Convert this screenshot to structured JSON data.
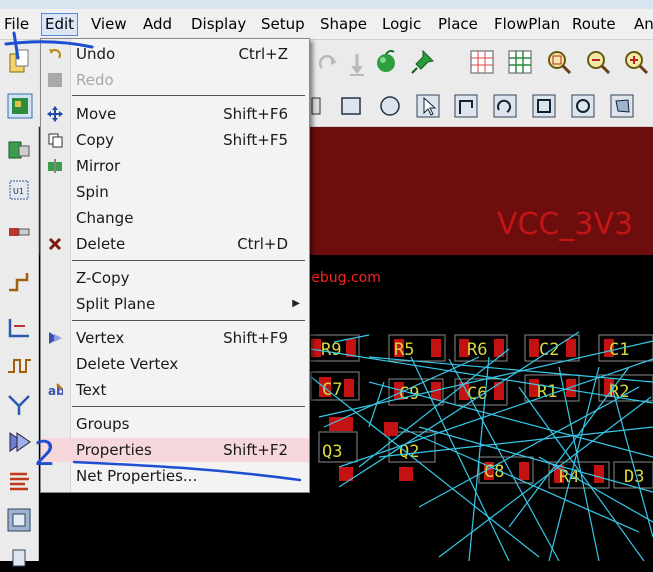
{
  "menubar": {
    "items": [
      "File",
      "Edit",
      "View",
      "Add",
      "Display",
      "Setup",
      "Shape",
      "Logic",
      "Place",
      "FlowPlan",
      "Route",
      "An"
    ],
    "active": "Edit"
  },
  "edit_menu": {
    "items": [
      {
        "label": "Undo",
        "shortcut": "Ctrl+Z",
        "icon": "undo-icon"
      },
      {
        "label": "Redo",
        "shortcut": "",
        "icon": "redo-icon",
        "disabled": true
      },
      {
        "label": "Move",
        "shortcut": "Shift+F6",
        "icon": "move-icon"
      },
      {
        "label": "Copy",
        "shortcut": "Shift+F5",
        "icon": "copy-icon"
      },
      {
        "label": "Mirror",
        "shortcut": "",
        "icon": "mirror-icon"
      },
      {
        "label": "Spin",
        "shortcut": ""
      },
      {
        "label": "Change",
        "shortcut": ""
      },
      {
        "label": "Delete",
        "shortcut": "Ctrl+D",
        "icon": "delete-icon"
      },
      {
        "label": "Z-Copy",
        "shortcut": ""
      },
      {
        "label": "Split Plane",
        "shortcut": "",
        "submenu": true
      },
      {
        "label": "Vertex",
        "shortcut": "Shift+F9",
        "icon": "vertex-icon"
      },
      {
        "label": "Delete Vertex",
        "shortcut": ""
      },
      {
        "label": "Text",
        "shortcut": "",
        "icon": "text-icon"
      },
      {
        "label": "Groups",
        "shortcut": ""
      },
      {
        "label": "Properties",
        "shortcut": "Shift+F2",
        "highlighted": true
      },
      {
        "label": "Net Properties...",
        "shortcut": ""
      }
    ]
  },
  "canvas": {
    "net_label": "VCC_3V3",
    "components": [
      "R9",
      "R5",
      "R6",
      "C2",
      "C1",
      "C7",
      "C9",
      "C6",
      "R1",
      "R2",
      "Q3",
      "Q2",
      "C8",
      "R4",
      "D3"
    ]
  },
  "watermark": "chipdebug.com",
  "annotations": {
    "step2_mark": "2"
  },
  "colors": {
    "board": "#6e0d0d",
    "pad": "#c41212",
    "silk": "#d8d83a",
    "ratsnest": "#36c8e8",
    "highlight": "#f5d7dc"
  }
}
